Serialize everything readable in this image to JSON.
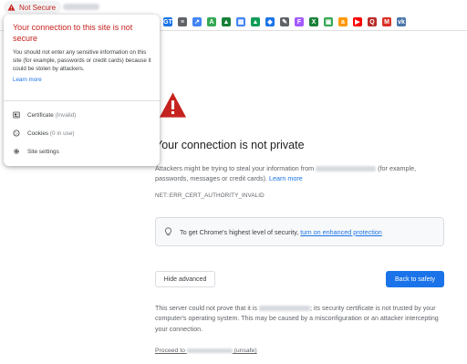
{
  "address_bar": {
    "security_chip_label": "Not Secure",
    "security_color": "#c5221f"
  },
  "bookmarks": [
    {
      "icon": "gt-icon",
      "label": "GT",
      "color": "#1a73e8"
    },
    {
      "icon": "analytics-icon",
      "label": "≡",
      "color": "#5f6368"
    },
    {
      "icon": "arrow-icon",
      "label": "↗",
      "color": "#4285f4"
    },
    {
      "icon": "ad-icon",
      "label": "A",
      "color": "#34a853"
    },
    {
      "icon": "chart-icon",
      "label": "▲",
      "color": "#188038"
    },
    {
      "icon": "grid-icon",
      "label": "▦",
      "color": "#4285f4"
    },
    {
      "icon": "flag-icon",
      "label": "▲",
      "color": "#0f9d58"
    },
    {
      "icon": "diamond-icon",
      "label": "◆",
      "color": "#1a73e8"
    },
    {
      "icon": "pen-icon",
      "label": "✎",
      "color": "#5f6368"
    },
    {
      "icon": "figma-icon",
      "label": "F",
      "color": "#a259ff"
    },
    {
      "icon": "sheet-icon",
      "label": "X",
      "color": "#188038"
    },
    {
      "icon": "app-icon",
      "label": "▣",
      "color": "#34a853"
    },
    {
      "icon": "amazon-icon",
      "label": "a",
      "color": "#ff9900"
    },
    {
      "icon": "youtube-icon",
      "label": "▶",
      "color": "#ff0000"
    },
    {
      "icon": "quora-icon",
      "label": "Q",
      "color": "#b92b27"
    },
    {
      "icon": "mail-icon",
      "label": "M",
      "color": "#d93025"
    },
    {
      "icon": "vk-icon",
      "label": "vk",
      "color": "#4a76a8"
    }
  ],
  "popup": {
    "title": "Your connection to this site is not secure",
    "body": "You should not enter any sensitive information on this site (for example, passwords or credit cards) because it could be stolen by attackers.",
    "learn_more": "Learn more",
    "items": {
      "certificate_label": "Certificate",
      "certificate_status": "(Invalid)",
      "cookies_label": "Cookies",
      "cookies_status": "(0 in use)",
      "site_settings_label": "Site settings"
    }
  },
  "main": {
    "heading": "Your connection is not private",
    "desc_before": "Attackers might be trying to steal your information from",
    "desc_after": "(for example, passwords, messages or credit cards).",
    "desc_learn_more": "Learn more",
    "error_code": "NET::ERR_CERT_AUTHORITY_INVALID",
    "protection_text": "To get Chrome's highest level of security,",
    "protection_link": "turn on enhanced protection",
    "hide_advanced": "Hide advanced",
    "back_to_safety": "Back to safety",
    "details_before": "This server could not prove that it is",
    "details_after": "; its security certificate is not trusted by your computer's operating system. This may be caused by a misconfiguration or an attacker intercepting your connection.",
    "proceed_prefix": "Proceed to",
    "proceed_suffix": "(unsafe)"
  },
  "colors": {
    "accent": "#1a73e8",
    "danger": "#c5221f",
    "warning_triangle": "#c5221f"
  }
}
